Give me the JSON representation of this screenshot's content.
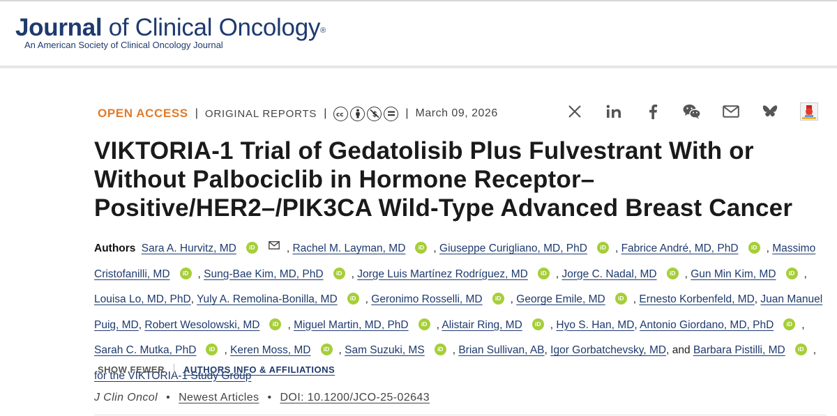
{
  "header": {
    "logo_strong": "Journal",
    "logo_rest": " of Clinical Oncology",
    "logo_reg": "®",
    "logo_subtitle": "An American Society of Clinical Oncology Journal"
  },
  "meta": {
    "access": "OPEN ACCESS",
    "separator": "|",
    "article_type": "ORIGINAL REPORTS",
    "license_icons": [
      "cc",
      "by",
      "nc",
      "nd"
    ],
    "date": "March 09, 2026"
  },
  "share": [
    "x-icon",
    "linkedin-icon",
    "facebook-icon",
    "wechat-icon",
    "email-icon",
    "bluesky-icon",
    "mendeley-icon"
  ],
  "article": {
    "title": "VIKTORIA-1 Trial of Gedatolisib Plus Fulvestrant With or Without Palbociclib in Hormone Receptor–Positive/HER2–/PIK3CA Wild-Type Advanced Breast Cancer"
  },
  "authors": {
    "label": "Authors",
    "orcid_label": "iD",
    "list": [
      {
        "name": "Sara A. Hurvitz, MD",
        "orcid": true,
        "mail": true
      },
      {
        "name": "Rachel M. Layman, MD",
        "orcid": true
      },
      {
        "name": "Giuseppe Curigliano, MD, PhD",
        "orcid": true
      },
      {
        "name": "Fabrice André, MD, PhD",
        "orcid": true
      },
      {
        "name": "Massimo Cristofanilli, MD",
        "orcid": true
      },
      {
        "name": "Sung-Bae Kim, MD, PhD",
        "orcid": true
      },
      {
        "name": "Jorge Luis Martínez Rodríguez, MD",
        "orcid": true
      },
      {
        "name": "Jorge C. Nadal, MD",
        "orcid": true
      },
      {
        "name": "Gun Min Kim, MD",
        "orcid": true
      },
      {
        "name": "Louisa Lo, MD, PhD",
        "orcid": false
      },
      {
        "name": "Yuly A. Remolina-Bonilla, MD",
        "orcid": true
      },
      {
        "name": "Geronimo Rosselli, MD",
        "orcid": true
      },
      {
        "name": "George Emile, MD",
        "orcid": true
      },
      {
        "name": "Ernesto Korbenfeld, MD",
        "orcid": false
      },
      {
        "name": "Juan Manuel Puig, MD",
        "orcid": false
      },
      {
        "name": "Robert Wesolowski, MD",
        "orcid": true
      },
      {
        "name": "Miguel Martin, MD, PhD",
        "orcid": true
      },
      {
        "name": "Alistair Ring, MD",
        "orcid": true
      },
      {
        "name": "Hyo S. Han, MD",
        "orcid": false
      },
      {
        "name": "Antonio Giordano, MD, PhD",
        "orcid": true
      },
      {
        "name": "Sarah C. Mutka, PhD",
        "orcid": true
      },
      {
        "name": "Keren Moss, MD",
        "orcid": true
      },
      {
        "name": "Sam Suzuki, MS",
        "orcid": true
      },
      {
        "name": "Brian Sullivan, AB",
        "orcid": false
      },
      {
        "name": "Igor Gorbatchevsky, MD",
        "orcid": false
      },
      {
        "name": "Barbara Pistilli, MD",
        "orcid": true
      }
    ],
    "conjunction": "and",
    "group": "for the VIKTORIA-1 Study Group"
  },
  "links": {
    "show_fewer": "SHOW FEWER",
    "affiliations": "AUTHORS INFO & AFFILIATIONS"
  },
  "citation": {
    "journal": "J Clin Oncol",
    "bullet": "•",
    "section": "Newest Articles",
    "doi": "DOI: 10.1200/JCO-25-02643"
  },
  "colors": {
    "brand_navy": "#1e3a6e",
    "open_access_orange": "#e07b2a",
    "orcid_green": "#a6ce39"
  }
}
